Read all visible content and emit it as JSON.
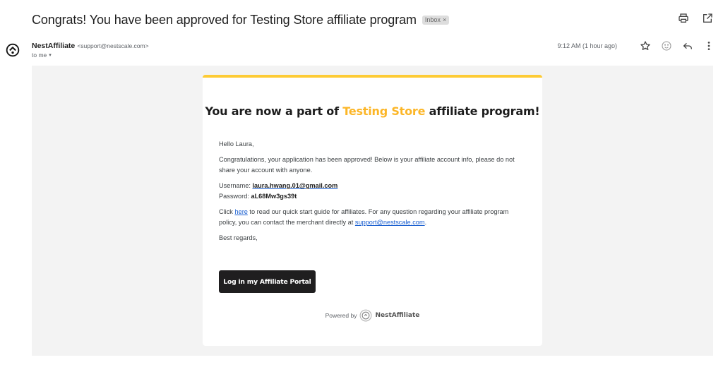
{
  "header": {
    "subject": "Congrats! You have been approved for Testing Store affiliate program",
    "label_badge": "Inbox",
    "label_remove": "×",
    "top_actions": [
      {
        "icon": "print-icon",
        "label": "Print all"
      },
      {
        "icon": "open-in-new-window-icon",
        "label": "In new window"
      }
    ]
  },
  "message": {
    "sender_name": "NestAffiliate",
    "sender_email": "<support@nestscale.com>",
    "recipient": "to me",
    "recipient_caret": "▾",
    "timestamp": "9:12 AM (1 hour ago)",
    "actions": [
      {
        "icon": "star-icon",
        "label": "Star"
      },
      {
        "icon": "emoji-icon",
        "label": "Add reaction"
      },
      {
        "icon": "reply-icon",
        "label": "Reply"
      },
      {
        "icon": "more-vert-icon",
        "label": "More"
      }
    ]
  },
  "email": {
    "accent_color": "#fdcb34",
    "title_prefix": "You are now a part of ",
    "title_highlight": "Testing Store",
    "title_suffix": " affiliate program!",
    "greeting": "Hello Laura,",
    "intro": "Congratulations, your application has been approved! Below is your affiliate account info, please do not share your account with anyone.",
    "username_label": "Username: ",
    "username_value": "laura.hwang.01@gmail.com",
    "password_label": "Password: ",
    "password_value": "aL68Mw3gs39t",
    "guide_prefix": "Click ",
    "guide_link": "here",
    "guide_mid": " to read our quick start guide for affiliates. For any question regarding your affiliate program policy, you can contact the merchant directly at ",
    "support_link": "support@nestscale.com",
    "guide_suffix": ".",
    "signoff": "Best regards,",
    "cta_label": "Log in my Affiliate Portal",
    "powered_by": "Powered by",
    "powered_brand": "NestAffiliate"
  }
}
